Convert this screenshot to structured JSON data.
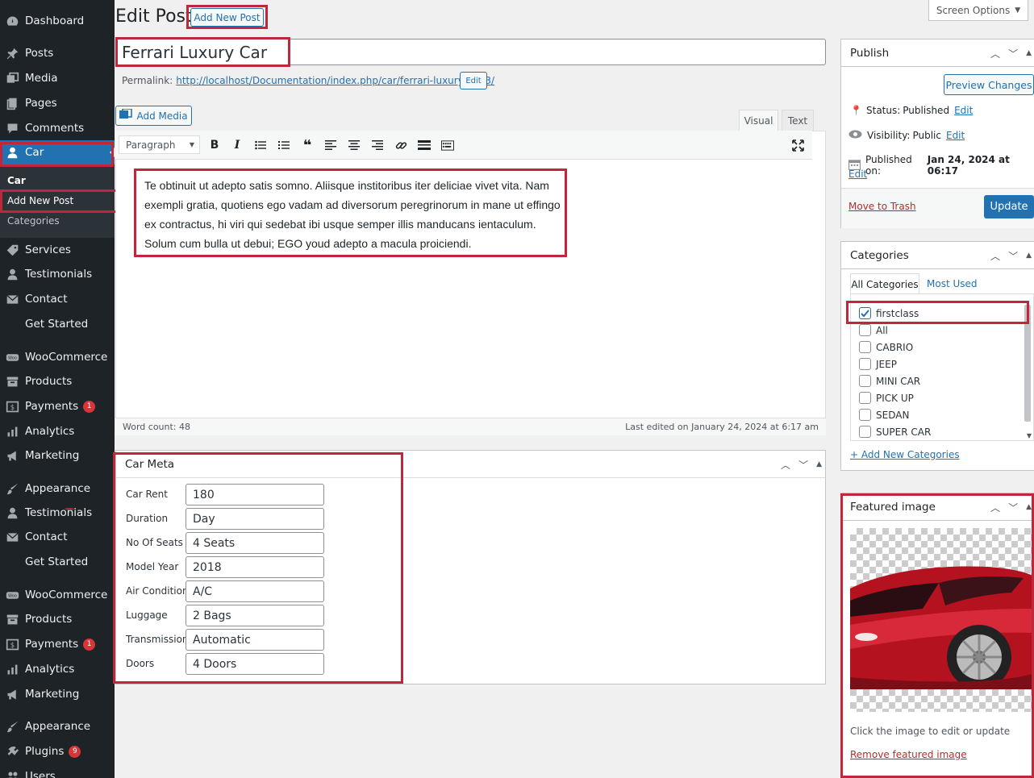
{
  "sidebar": {
    "items": [
      {
        "label": "Dashboard",
        "icon": "dashboard-icon"
      },
      {
        "label": "Posts",
        "icon": "pin-icon"
      },
      {
        "label": "Media",
        "icon": "media-icon"
      },
      {
        "label": "Pages",
        "icon": "pages-icon"
      },
      {
        "label": "Comments",
        "icon": "comment-icon"
      },
      {
        "label": "Car",
        "icon": "user-icon"
      },
      {
        "label": "Services",
        "icon": "tag-icon"
      },
      {
        "label": "Testimonials",
        "icon": "user-icon"
      },
      {
        "label": "Contact",
        "icon": "mail-icon"
      },
      {
        "label": "Get Started",
        "icon": ""
      },
      {
        "label": "WooCommerce",
        "icon": "woo-icon"
      },
      {
        "label": "Products",
        "icon": "archive-icon"
      },
      {
        "label": "Payments",
        "icon": "dollar-icon",
        "badge": "1"
      },
      {
        "label": "Analytics",
        "icon": "chart-icon"
      },
      {
        "label": "Marketing",
        "icon": "megaphone-icon"
      },
      {
        "label": "Appearance",
        "icon": "brush-icon"
      },
      {
        "label": "Testimonials",
        "icon": "user-icon"
      },
      {
        "label": "Contact",
        "icon": "mail-icon"
      },
      {
        "label": "Get Started",
        "icon": ""
      },
      {
        "label": "WooCommerce",
        "icon": "woo-icon"
      },
      {
        "label": "Products",
        "icon": "archive-icon"
      },
      {
        "label": "Payments",
        "icon": "dollar-icon",
        "badge": "1"
      },
      {
        "label": "Analytics",
        "icon": "chart-icon"
      },
      {
        "label": "Marketing",
        "icon": "megaphone-icon"
      },
      {
        "label": "Appearance",
        "icon": "brush-icon"
      },
      {
        "label": "Plugins",
        "icon": "plugin-icon",
        "badge": "9"
      },
      {
        "label": "Users",
        "icon": "users-icon"
      }
    ],
    "submenu": {
      "head": "Car",
      "add_new": "Add New Post",
      "categories": "Categories"
    }
  },
  "header": {
    "title": "Edit Post",
    "add_new": "Add New Post",
    "screen_options": "Screen Options"
  },
  "post": {
    "title": "Ferrari Luxury Car",
    "permalink_label": "Permalink:",
    "permalink_url": "http://localhost/Documentation/index.php/car/ferrari-luxury-car-3/",
    "permalink_edit": "Edit",
    "add_media": "Add Media",
    "tab_visual": "Visual",
    "tab_text": "Text",
    "format_select": "Paragraph",
    "content": "Te obtinuit ut adepto satis somno. Aliisque institoribus iter deliciae vivet vita. Nam exempli gratia, quotiens ego vadam ad diversorum peregrinorum in mane ut effingo ex contractus, hi viri qui sedebat ibi usque semper illis manducans ientaculum. Solum cum bulla ut debui; EGO youd adepto a macula proiciendi.",
    "word_count": "Word count: 48",
    "last_edited": "Last edited on January 24, 2024 at 6:17 am"
  },
  "car_meta": {
    "title": "Car Meta",
    "fields": [
      {
        "label": "Car Rent",
        "value": "180"
      },
      {
        "label": "Duration",
        "value": "Day"
      },
      {
        "label": "No Of Seats",
        "value": "4 Seats"
      },
      {
        "label": "Model Year",
        "value": "2018"
      },
      {
        "label": "Air Condition",
        "value": "A/C"
      },
      {
        "label": "Luggage",
        "value": "2 Bags"
      },
      {
        "label": "Transmission",
        "value": "Automatic"
      },
      {
        "label": "Doors",
        "value": "4 Doors"
      }
    ]
  },
  "publish": {
    "title": "Publish",
    "preview": "Preview Changes",
    "status_label": "Status:",
    "status_value": "Published",
    "visibility_label": "Visibility:",
    "visibility_value": "Public",
    "published_label": "Published on:",
    "published_value": "Jan 24, 2024 at 06:17",
    "edit": "Edit",
    "trash": "Move to Trash",
    "update": "Update"
  },
  "categories": {
    "title": "Categories",
    "tab_all": "All Categories",
    "tab_most": "Most Used",
    "items": [
      {
        "label": "firstclass",
        "checked": true
      },
      {
        "label": "All",
        "checked": false
      },
      {
        "label": "CABRIO",
        "checked": false
      },
      {
        "label": "JEEP",
        "checked": false
      },
      {
        "label": "MINI CAR",
        "checked": false
      },
      {
        "label": "PICK UP",
        "checked": false
      },
      {
        "label": "SEDAN",
        "checked": false
      },
      {
        "label": "SUPER CAR",
        "checked": false
      }
    ],
    "add_new": "+ Add New Categories"
  },
  "featured": {
    "title": "Featured image",
    "hint": "Click the image to edit or update",
    "remove": "Remove featured image"
  },
  "colors": {
    "sidebar_bg": "#1d2327",
    "accent": "#2271b1",
    "highlight": "#c0273a",
    "car_red": "#b5121f"
  }
}
